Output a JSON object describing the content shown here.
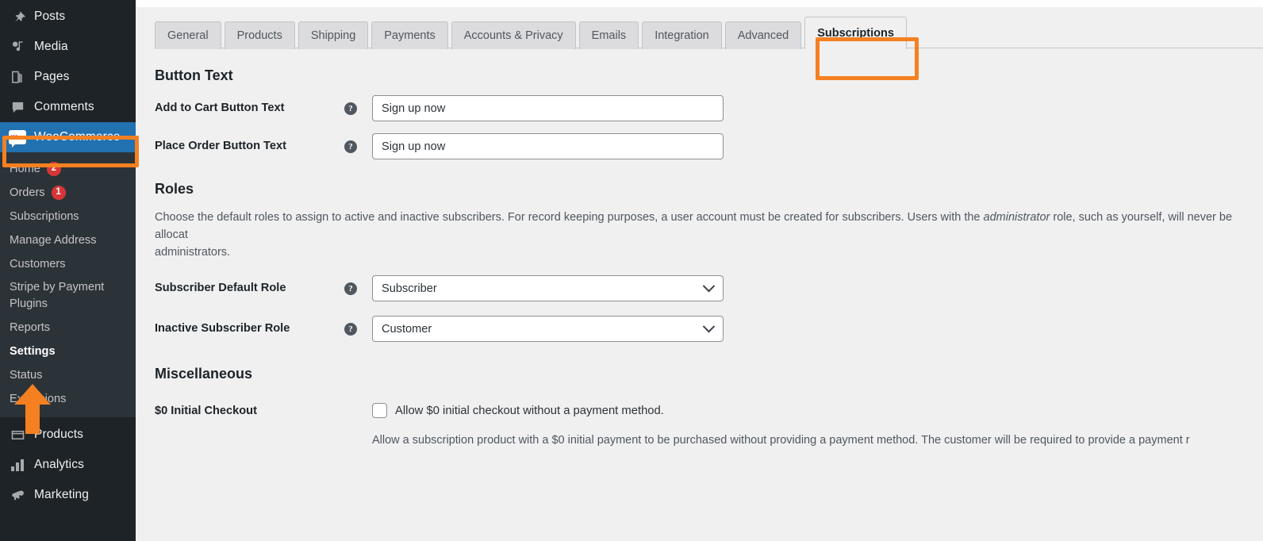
{
  "sidebar": {
    "top_items": [
      {
        "label": "Posts",
        "icon": "pin-icon"
      },
      {
        "label": "Media",
        "icon": "media-icon"
      },
      {
        "label": "Pages",
        "icon": "pages-icon"
      },
      {
        "label": "Comments",
        "icon": "comments-icon"
      }
    ],
    "current_item": {
      "label": "WooCommerce",
      "icon": "woocommerce-icon",
      "badge_text": "Woo"
    },
    "submenu": [
      {
        "label": "Home",
        "count": "2"
      },
      {
        "label": "Orders",
        "count": "1"
      },
      {
        "label": "Subscriptions",
        "count": ""
      },
      {
        "label": "Manage Address",
        "count": ""
      },
      {
        "label": "Customers",
        "count": ""
      },
      {
        "label": "Stripe by Payment Plugins",
        "count": ""
      },
      {
        "label": "Reports",
        "count": ""
      },
      {
        "label": "Settings",
        "count": ""
      },
      {
        "label": "Status",
        "count": ""
      },
      {
        "label": "Extensions",
        "count": ""
      }
    ],
    "bottom_items": [
      {
        "label": "Products",
        "icon": "products-box-icon"
      },
      {
        "label": "Analytics",
        "icon": "bar-chart-icon"
      },
      {
        "label": "Marketing",
        "icon": "megaphone-icon"
      }
    ]
  },
  "tabs": [
    {
      "label": "General",
      "active": false
    },
    {
      "label": "Products",
      "active": false
    },
    {
      "label": "Shipping",
      "active": false
    },
    {
      "label": "Payments",
      "active": false
    },
    {
      "label": "Accounts & Privacy",
      "active": false
    },
    {
      "label": "Emails",
      "active": false
    },
    {
      "label": "Integration",
      "active": false
    },
    {
      "label": "Advanced",
      "active": false
    },
    {
      "label": "Subscriptions",
      "active": true
    }
  ],
  "sections": {
    "button_text": {
      "heading": "Button Text",
      "add_to_cart": {
        "label": "Add to Cart Button Text",
        "value": "Sign up now",
        "help": "?"
      },
      "place_order": {
        "label": "Place Order Button Text",
        "value": "Sign up now",
        "help": "?"
      }
    },
    "roles": {
      "heading": "Roles",
      "description_part1": "Choose the default roles to assign to active and inactive subscribers. For record keeping purposes, a user account must be created for subscribers. Users with the ",
      "description_emphasis": "administrator",
      "description_part2": " role, such as yourself, will never be allocat",
      "description_line2": "administrators.",
      "subscriber_default": {
        "label": "Subscriber Default Role",
        "value": "Subscriber",
        "help": "?"
      },
      "inactive_subscriber": {
        "label": "Inactive Subscriber Role",
        "value": "Customer",
        "help": "?"
      }
    },
    "miscellaneous": {
      "heading": "Miscellaneous",
      "zero_initial_checkout": {
        "label": "$0 Initial Checkout",
        "checkbox_label": "Allow $0 initial checkout without a payment method.",
        "checked": false,
        "help_text": "Allow a subscription product with a $0 initial payment to be purchased without providing a payment method. The customer will be required to provide a payment r"
      }
    }
  },
  "annotations": {
    "color": "#f58021",
    "highlight_sidebar_item": "WooCommerce",
    "highlight_tab": "Subscriptions",
    "arrow_points_to": "Settings"
  }
}
